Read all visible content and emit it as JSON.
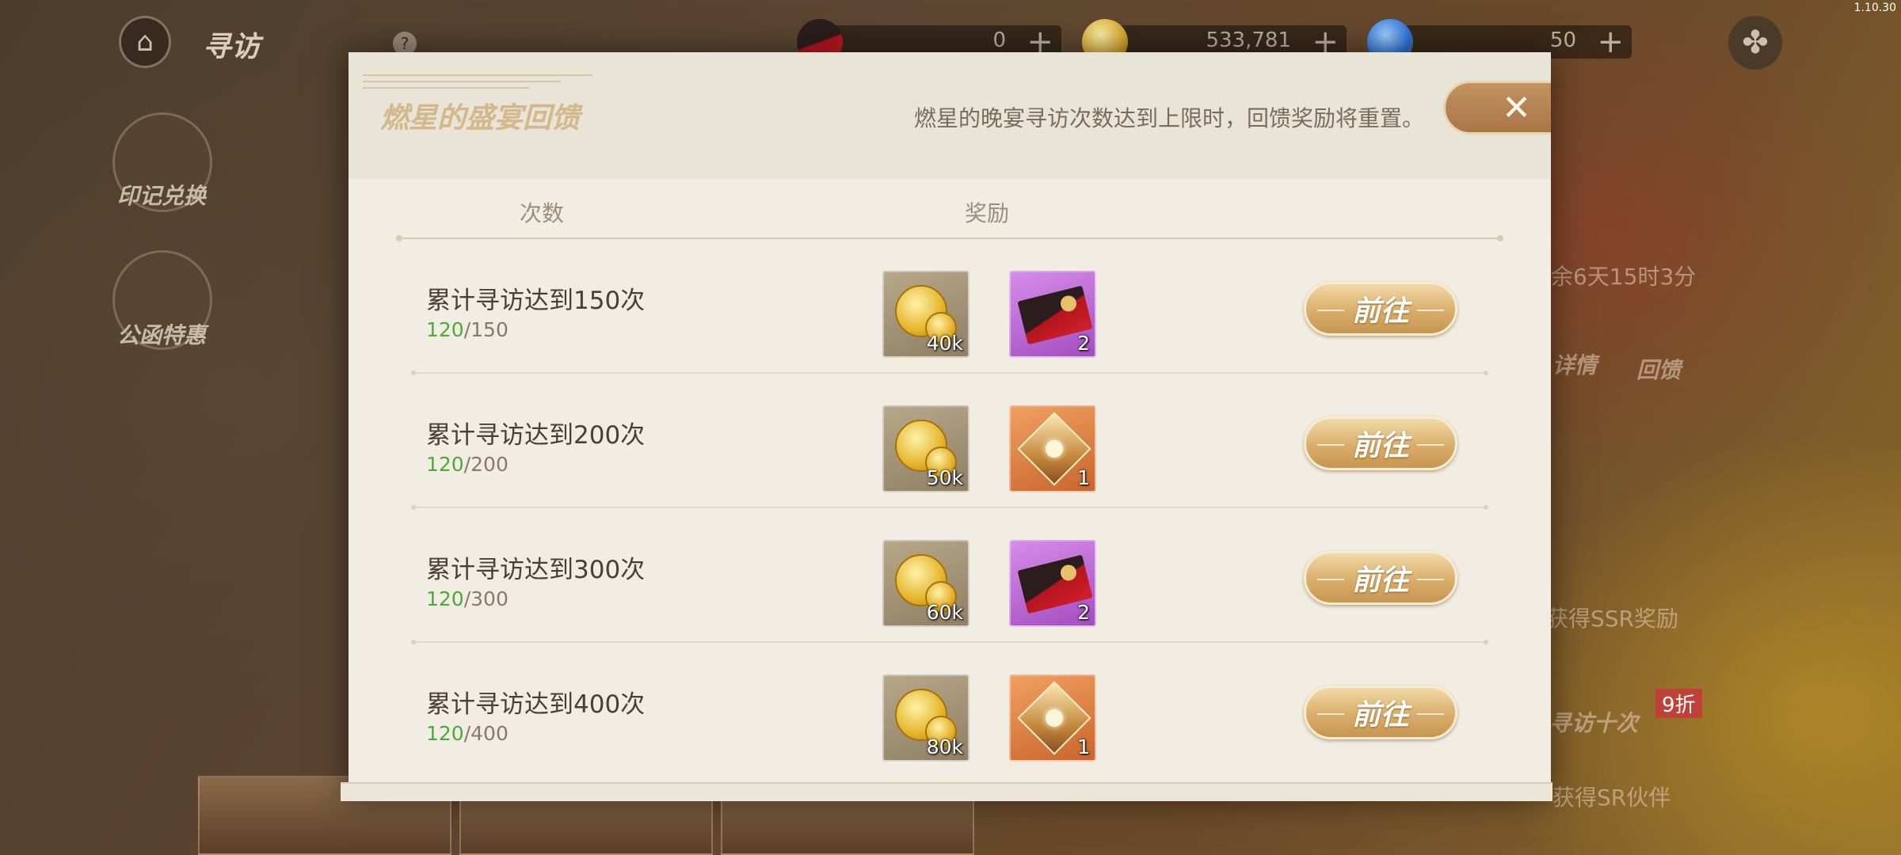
{
  "version": "1.10.30",
  "topbar": {
    "title": "寻访",
    "help_icon": "question-icon",
    "currencies": [
      {
        "name": "envelope-currency-icon",
        "value": "0",
        "color": "#c0202a"
      },
      {
        "name": "coin-currency-icon",
        "value": "533,781",
        "color": "#d6a62c"
      },
      {
        "name": "gem-currency-icon",
        "value": "50",
        "color": "#2b6fd6"
      }
    ]
  },
  "sidebar": {
    "items": [
      {
        "label": "印记兑换"
      },
      {
        "label": "公函特惠"
      }
    ]
  },
  "modal": {
    "title": "燃星的盛宴回馈",
    "notice": "燃星的晚宴寻访次数达到上限时，回馈奖励将重置。",
    "columns": {
      "count": "次数",
      "reward": "奖励"
    },
    "go_label": "前往",
    "rows": [
      {
        "title": "累计寻访达到150次",
        "current": "120",
        "target": "/150",
        "coin_qty": "40k",
        "item_type": "envelope",
        "item_qty": "2"
      },
      {
        "title": "累计寻访达到200次",
        "current": "120",
        "target": "/200",
        "coin_qty": "50k",
        "item_type": "crystal",
        "item_qty": "1"
      },
      {
        "title": "累计寻访达到300次",
        "current": "120",
        "target": "/300",
        "coin_qty": "60k",
        "item_type": "envelope",
        "item_qty": "2"
      },
      {
        "title": "累计寻访达到400次",
        "current": "120",
        "target": "/400",
        "coin_qty": "80k",
        "item_type": "crystal",
        "item_qty": "1"
      }
    ]
  },
  "background": {
    "countdown": "余6天15时3分",
    "details_label": "详情",
    "feedback_label": "回馈",
    "ssr_text": "获得SSR奖励",
    "draw_ten_label": "寻访十次",
    "discount_badge": "9折",
    "sr_text": "获得SR伙伴"
  }
}
